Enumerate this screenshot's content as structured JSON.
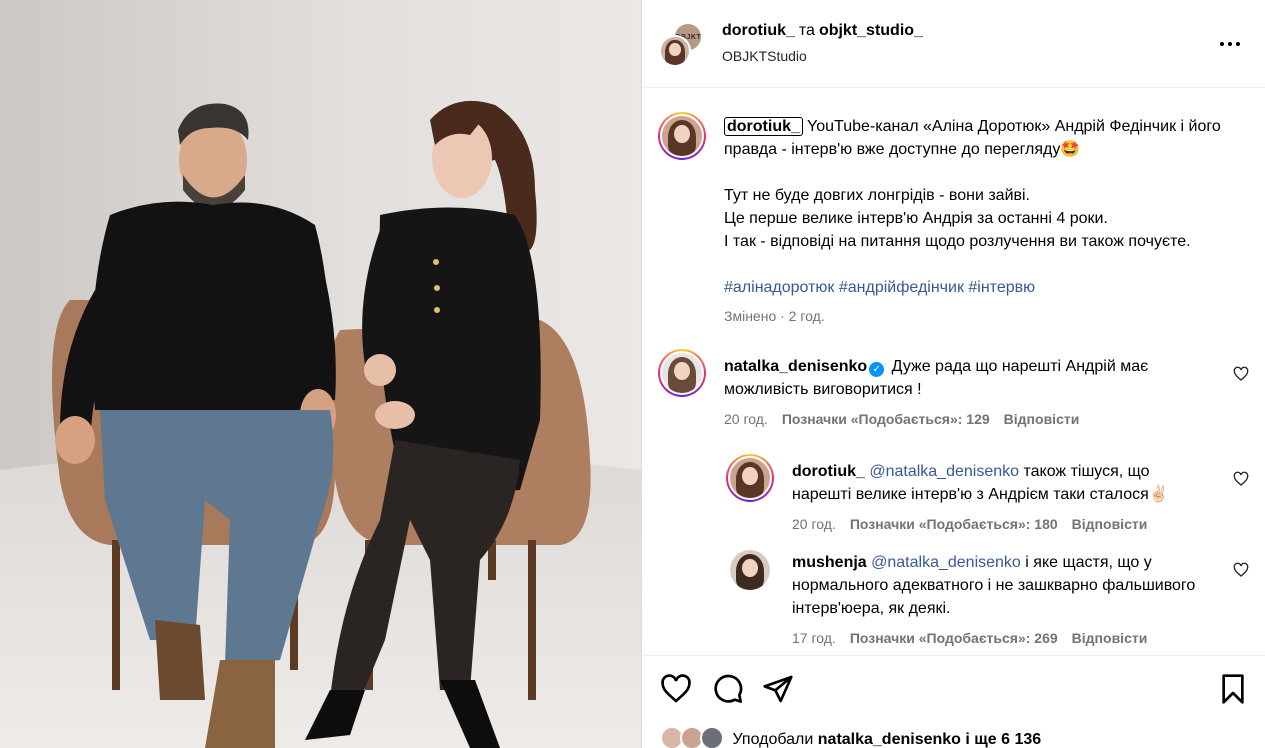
{
  "header": {
    "user1": "dorotiuk_",
    "separator": "та",
    "user2": "objkt_studio_",
    "subtitle": "OBJKTStudio",
    "logo_text": "OBJKT"
  },
  "caption": {
    "username": "dorotiuk_",
    "line1": "YouTube-канал «Аліна Доротюк» Андрій Федінчик і його правда - інтерв'ю вже доступне до перегляду🤩",
    "line2": "Тут не буде довгих лонгрідів - вони зайві.",
    "line3": "Це перше велике інтерв'ю Андрія за останні 4 роки.",
    "line4": "І так - відповіді на питання щодо розлучення ви також почуєте.",
    "hashtags": "#алінадоротюк #андрійфедінчик #інтервю",
    "meta": "Змінено · 2 год."
  },
  "comments": [
    {
      "username": "natalka_denisenko",
      "verified": true,
      "text": "Дуже рада що нарешті Андрій має можливість виговоритися !",
      "time": "20 год.",
      "likes": "Позначки «Подобається»: 129",
      "reply": "Відповісти"
    },
    {
      "username": "dorotiuk_",
      "mention": "@natalka_denisenko",
      "text": "також тішуся, що нарешті велике інтерв'ю з Андрієм таки сталося✌🏻",
      "time": "20 год.",
      "likes": "Позначки «Подобається»: 180",
      "reply": "Відповісти"
    },
    {
      "username": "mushenja",
      "mention": "@natalka_denisenko",
      "text": "і яке щастя, що у нормального адекватного і не зашкварно фальшивого інтерв'юера, як деякі.",
      "time": "17 год.",
      "likes": "Позначки «Подобається»: 269",
      "reply": "Відповісти"
    }
  ],
  "likes_line": {
    "prefix": "Уподобали",
    "user": "natalka_denisenko",
    "suffix": "і ще 6 136"
  },
  "icons": [
    "more-icon",
    "heart-icon",
    "comment-icon",
    "share-icon",
    "bookmark-icon",
    "verified-icon"
  ],
  "colors": {
    "link": "#385898",
    "verified": "#0095f6",
    "muted": "#737373"
  }
}
